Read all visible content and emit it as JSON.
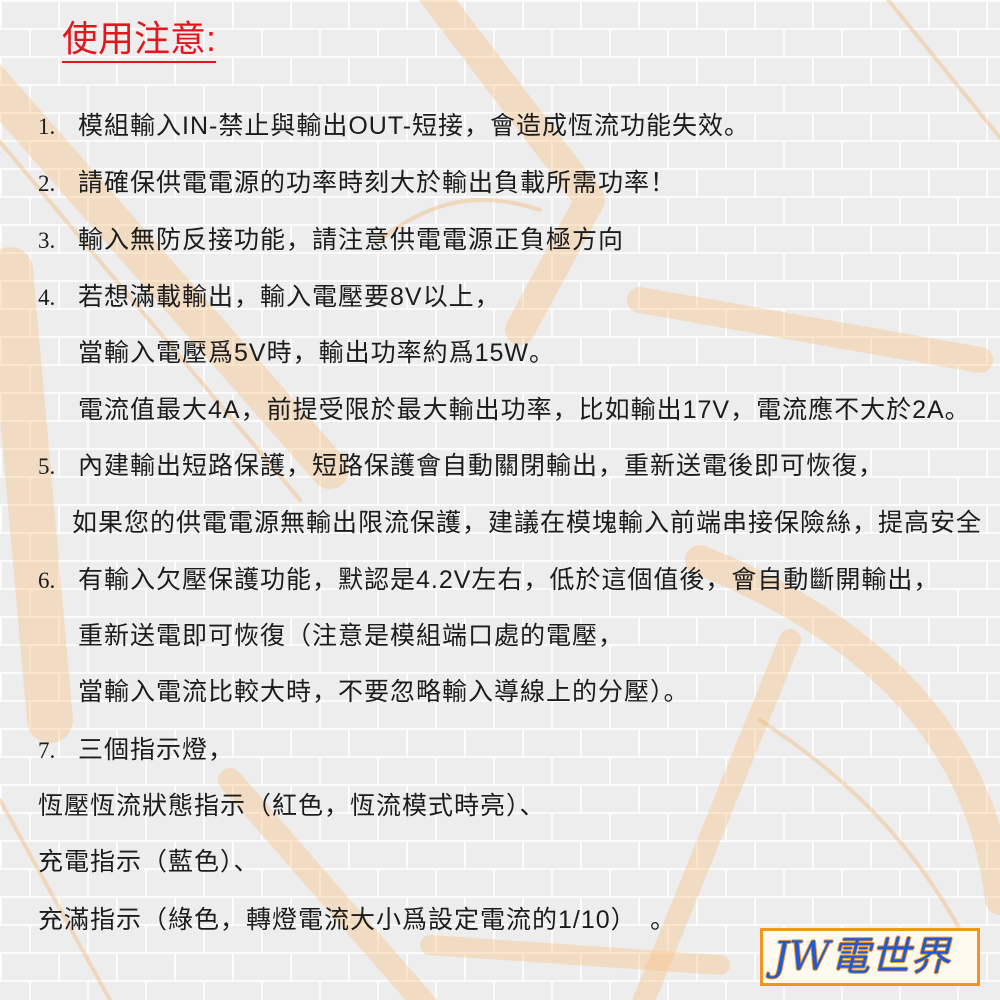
{
  "title": "使用注意:",
  "notes": [
    {
      "number": "1.",
      "lines": [
        "模組輸入IN-禁止與輸出OUT-短接，會造成恆流功能失效。"
      ]
    },
    {
      "number": "2.",
      "lines": [
        "請確保供電電源的功率時刻大於輸出負載所需功率！"
      ]
    },
    {
      "number": "3.",
      "lines": [
        "輸入無防反接功能，請注意供電電源正負極方向"
      ]
    },
    {
      "number": "4.",
      "lines": [
        "若想滿載輸出，輸入電壓要8V以上，",
        "當輸入電壓爲5V時，輸出功率約爲15W。",
        "電流值最大4A，前提受限於最大輸出功率，比如輸出17V，電流應不大於2A。"
      ]
    },
    {
      "number": "5.",
      "lines": [
        "內建輸出短路保護，短路保護會自動關閉輸出，重新送電後即可恢復，",
        "如果您的供電電源無輸出限流保護，建議在模塊輸入前端串接保險絲，提高安全"
      ]
    },
    {
      "number": "6.",
      "lines": [
        "有輸入欠壓保護功能，默認是4.2V左右，低於這個值後，會自動斷開輸出，",
        "重新送電即可恢復（注意是模組端口處的電壓，",
        "當輸入電流比較大時，不要忽略輸入導線上的分壓）。"
      ]
    },
    {
      "number": "7.",
      "lines": [
        "三個指示燈，",
        "恆壓恆流狀態指示（紅色，恆流模式時亮）、",
        "充電指示（藍色）、",
        "充滿指示（綠色，轉燈電流大小爲設定電流的1/10）　。"
      ]
    }
  ],
  "logo": {
    "text": "JW電世界"
  },
  "colors": {
    "title": "#e4161d",
    "text": "#1c1c1c",
    "logo_text": "#1f5ad6",
    "logo_border": "#f0961e",
    "watermark": "#f9c48a"
  }
}
